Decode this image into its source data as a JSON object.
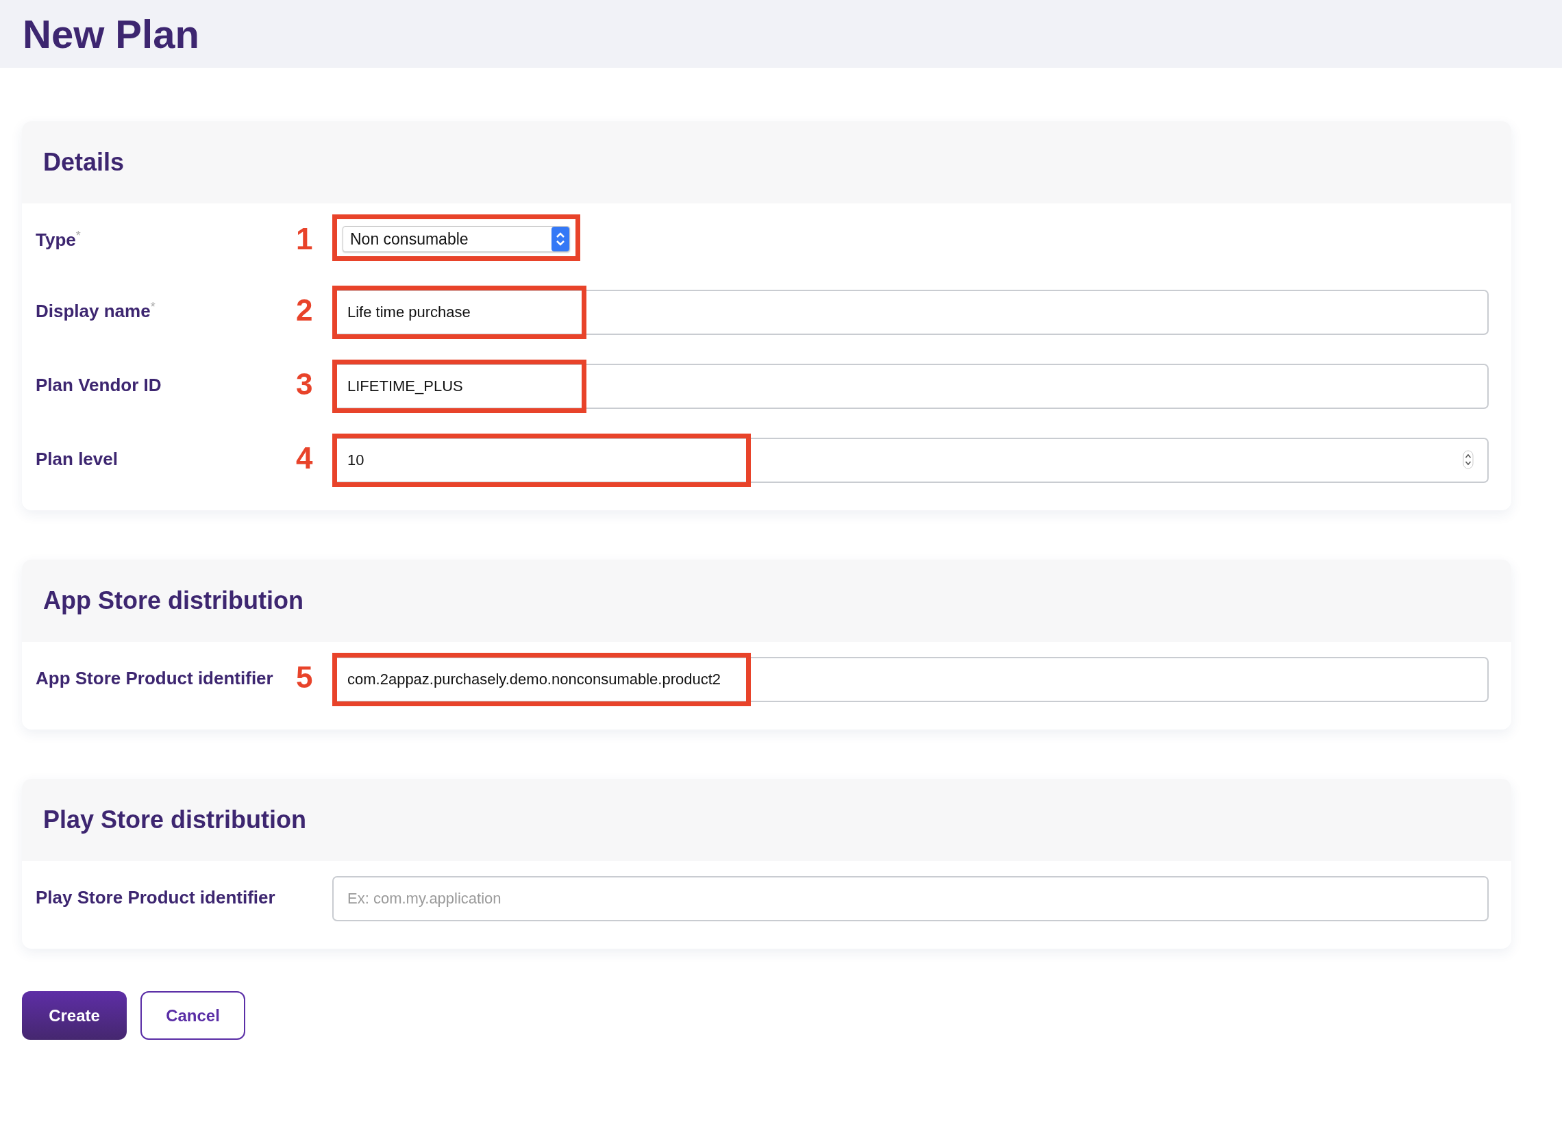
{
  "page": {
    "title": "New Plan"
  },
  "sections": [
    {
      "title": "Details",
      "fields": [
        {
          "label": "Type",
          "required_mark": "*",
          "marker": "1",
          "kind": "select",
          "value": "Non consumable",
          "highlight": true
        },
        {
          "label": "Display name",
          "required_mark": "*",
          "marker": "2",
          "kind": "text",
          "value": "Life time purchase",
          "highlight": true
        },
        {
          "label": "Plan Vendor ID",
          "marker": "3",
          "kind": "text",
          "value": "LIFETIME_PLUS",
          "highlight": true
        },
        {
          "label": "Plan level",
          "marker": "4",
          "kind": "number",
          "value": "10",
          "highlight": true
        }
      ]
    },
    {
      "title": "App Store distribution",
      "fields": [
        {
          "label": "App Store Product identifier",
          "marker": "5",
          "kind": "text",
          "value": "com.2appaz.purchasely.demo.nonconsumable.product2",
          "highlight": true
        }
      ]
    },
    {
      "title": "Play Store distribution",
      "fields": [
        {
          "label": "Play Store Product identifier",
          "kind": "text",
          "placeholder": "Ex: com.my.application",
          "highlight": false
        }
      ]
    }
  ],
  "buttons": [
    {
      "label": "Create",
      "kind": "primary"
    },
    {
      "label": "Cancel",
      "kind": "outline"
    }
  ]
}
